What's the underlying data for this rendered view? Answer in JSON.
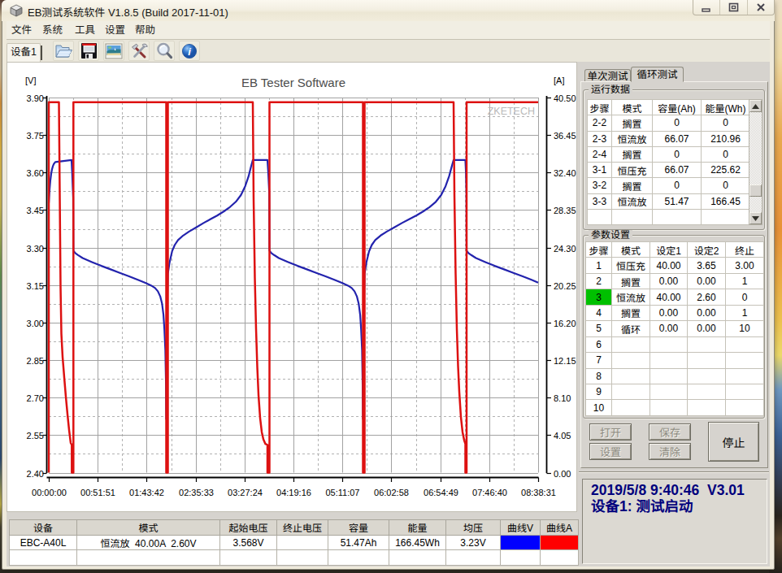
{
  "window": {
    "title": "EB测试系统软件 V1.8.5 (Build 2017-11-01)",
    "caption_buttons": {
      "minimize": "minimize",
      "maximize": "maximize",
      "close": "close"
    }
  },
  "menu": {
    "items": [
      "文件",
      "系统",
      "工具",
      "设置",
      "帮助"
    ]
  },
  "toolbar": {
    "device_tab": "设备1",
    "icons": [
      "open-file-icon",
      "save-icon",
      "export-image-icon",
      "tools-icon",
      "zoom-icon",
      "info-icon"
    ]
  },
  "right_panel": {
    "tabs": [
      {
        "label": "单次测试",
        "active": false
      },
      {
        "label": "循环测试",
        "active": true
      }
    ],
    "run_data": {
      "group_label": "运行数据",
      "columns": [
        "步骤",
        "模式",
        "容量(Ah)",
        "能量(Wh)"
      ],
      "rows": [
        [
          "2-2",
          "搁置",
          "0",
          "0"
        ],
        [
          "2-3",
          "恒流放",
          "66.07",
          "210.96"
        ],
        [
          "2-4",
          "搁置",
          "0",
          "0"
        ],
        [
          "3-1",
          "恒压充",
          "66.07",
          "225.62"
        ],
        [
          "3-2",
          "搁置",
          "0",
          "0"
        ],
        [
          "3-3",
          "恒流放",
          "51.47",
          "166.45"
        ],
        [
          "",
          "",
          "",
          ""
        ]
      ]
    },
    "parameters": {
      "group_label": "参数设置",
      "columns": [
        "步骤",
        "模式",
        "设定1",
        "设定2",
        "终止"
      ],
      "rows": [
        [
          "1",
          "恒压充",
          "40.00",
          "3.65",
          "3.00"
        ],
        [
          "2",
          "搁置",
          "0.00",
          "0.00",
          "1"
        ],
        [
          "3",
          "恒流放",
          "40.00",
          "2.60",
          "0"
        ],
        [
          "4",
          "搁置",
          "0.00",
          "0.00",
          "1"
        ],
        [
          "5",
          "循环",
          "0.00",
          "0.00",
          "10"
        ],
        [
          "6",
          "",
          "",
          "",
          ""
        ],
        [
          "7",
          "",
          "",
          "",
          ""
        ],
        [
          "8",
          "",
          "",
          "",
          ""
        ],
        [
          "9",
          "",
          "",
          "",
          ""
        ],
        [
          "10",
          "",
          "",
          "",
          ""
        ]
      ],
      "active_step_row": 3,
      "active_step_color": "#00c000"
    },
    "buttons": {
      "open": "打开",
      "save": "保存",
      "set": "设置",
      "clear": "清除",
      "stop": "停止"
    },
    "status_log": {
      "line1": "2019/5/8 9:40:46  V3.01",
      "line2": "设备1: 测试启动",
      "text_color": "#00007d"
    }
  },
  "bottom_table": {
    "columns": [
      "设备",
      "模式",
      "起始电压",
      "终止电压",
      "容量",
      "能量",
      "均压",
      "曲线V",
      "曲线A"
    ],
    "row": {
      "device": "EBC-A40L",
      "mode": "恒流放  40.00A  2.60V",
      "start_voltage": "3.568V",
      "end_voltage": "",
      "capacity": "51.47Ah",
      "energy": "166.45Wh",
      "avg_voltage": "3.23V",
      "curve_v_color": "#0000ff",
      "curve_a_color": "#ff0000"
    }
  },
  "chart_data": {
    "type": "line",
    "title": "EB Tester Software",
    "watermark": "ZKETECH",
    "x_axis": {
      "min": 0,
      "max": 31111,
      "tick_labels": [
        "00:00:00",
        "00:51:51",
        "01:43:42",
        "02:35:33",
        "03:27:24",
        "04:19:16",
        "05:11:07",
        "06:02:58",
        "06:54:49",
        "07:46:40",
        "08:38:31"
      ]
    },
    "y_left": {
      "unit": "[V]",
      "min": 2.4,
      "max": 3.9,
      "tick_labels": [
        "3.90",
        "3.75",
        "3.60",
        "3.45",
        "3.30",
        "3.15",
        "3.00",
        "2.85",
        "2.70",
        "2.55",
        "2.40"
      ]
    },
    "y_right": {
      "unit": "[A]",
      "min": 0.0,
      "max": 40.5,
      "tick_labels": [
        "40.50",
        "36.45",
        "32.40",
        "28.35",
        "24.30",
        "20.25",
        "16.20",
        "12.15",
        "8.10",
        "4.05",
        "0.00"
      ]
    },
    "grid": {
      "major_color": "#a2a2a2",
      "minor_color": "#b2b2b2",
      "minor_dashed": true
    },
    "series": [
      {
        "name": "voltage",
        "axis": "left",
        "color": "#2323ad",
        "width": 2.2,
        "points": [
          [
            0,
            3.478
          ],
          [
            52,
            3.533
          ],
          [
            103,
            3.57
          ],
          [
            155,
            3.596
          ],
          [
            207,
            3.613
          ],
          [
            258,
            3.625
          ],
          [
            310,
            3.633
          ],
          [
            362,
            3.638
          ],
          [
            413,
            3.642
          ],
          [
            1447,
            3.65
          ],
          [
            1488,
            3.6
          ],
          [
            1525,
            3.54
          ],
          [
            1550,
            3.5
          ],
          [
            1566,
            3.288
          ],
          [
            1684,
            3.278
          ],
          [
            1861,
            3.27
          ],
          [
            2156,
            3.258
          ],
          [
            2451,
            3.25
          ],
          [
            2746,
            3.242
          ],
          [
            3336,
            3.227
          ],
          [
            3927,
            3.213
          ],
          [
            4517,
            3.199
          ],
          [
            5107,
            3.185
          ],
          [
            5697,
            3.17
          ],
          [
            6169,
            3.158
          ],
          [
            6523,
            3.148
          ],
          [
            6759,
            3.138
          ],
          [
            6937,
            3.125
          ],
          [
            7084,
            3.105
          ],
          [
            7202,
            3.075
          ],
          [
            7291,
            3.03
          ],
          [
            7350,
            2.975
          ],
          [
            7409,
            2.89
          ],
          [
            7450,
            2.75
          ],
          [
            7468,
            2.615
          ],
          [
            7483,
            2.8
          ],
          [
            7509,
            3.0
          ],
          [
            7545,
            3.12
          ],
          [
            7571,
            3.195
          ],
          [
            7679,
            3.24
          ],
          [
            7841,
            3.285
          ],
          [
            8003,
            3.31
          ],
          [
            8219,
            3.33
          ],
          [
            8543,
            3.348
          ],
          [
            8921,
            3.364
          ],
          [
            9353,
            3.38
          ],
          [
            9839,
            3.398
          ],
          [
            10271,
            3.413
          ],
          [
            10703,
            3.428
          ],
          [
            11135,
            3.445
          ],
          [
            11513,
            3.462
          ],
          [
            11891,
            3.483
          ],
          [
            12215,
            3.51
          ],
          [
            12485,
            3.545
          ],
          [
            12702,
            3.585
          ],
          [
            12864,
            3.625
          ],
          [
            12972,
            3.65
          ],
          [
            13902,
            3.65
          ],
          [
            13953,
            3.6
          ],
          [
            14015,
            3.52
          ],
          [
            14031,
            3.288
          ],
          [
            14150,
            3.278
          ],
          [
            14328,
            3.27
          ],
          [
            14625,
            3.258
          ],
          [
            14922,
            3.25
          ],
          [
            15220,
            3.242
          ],
          [
            15814,
            3.227
          ],
          [
            16408,
            3.213
          ],
          [
            17003,
            3.199
          ],
          [
            17597,
            3.185
          ],
          [
            18191,
            3.17
          ],
          [
            18667,
            3.158
          ],
          [
            19023,
            3.148
          ],
          [
            19261,
            3.138
          ],
          [
            19439,
            3.125
          ],
          [
            19588,
            3.105
          ],
          [
            19707,
            3.075
          ],
          [
            19796,
            3.03
          ],
          [
            19855,
            2.975
          ],
          [
            19915,
            2.89
          ],
          [
            19956,
            2.75
          ],
          [
            19974,
            2.615
          ],
          [
            19990,
            2.8
          ],
          [
            20015,
            3.0
          ],
          [
            20052,
            3.12
          ],
          [
            20077,
            3.195
          ],
          [
            20191,
            3.24
          ],
          [
            20360,
            3.285
          ],
          [
            20530,
            3.31
          ],
          [
            20757,
            3.33
          ],
          [
            21096,
            3.348
          ],
          [
            21492,
            3.364
          ],
          [
            21945,
            3.38
          ],
          [
            22454,
            3.398
          ],
          [
            22907,
            3.413
          ],
          [
            23360,
            3.428
          ],
          [
            23812,
            3.445
          ],
          [
            24208,
            3.462
          ],
          [
            24605,
            3.483
          ],
          [
            24944,
            3.51
          ],
          [
            25227,
            3.545
          ],
          [
            25453,
            3.585
          ],
          [
            25623,
            3.625
          ],
          [
            25736,
            3.65
          ],
          [
            26486,
            3.65
          ],
          [
            26522,
            3.6
          ],
          [
            26553,
            3.52
          ],
          [
            26563,
            3.288
          ],
          [
            26682,
            3.278
          ],
          [
            26860,
            3.27
          ],
          [
            27158,
            3.258
          ],
          [
            27455,
            3.25
          ],
          [
            27752,
            3.242
          ],
          [
            28346,
            3.227
          ],
          [
            28940,
            3.213
          ],
          [
            29535,
            3.199
          ],
          [
            30129,
            3.185
          ],
          [
            30723,
            3.17
          ],
          [
            31110,
            3.16
          ]
        ]
      },
      {
        "name": "current",
        "axis": "right",
        "color": "#dd1111",
        "width": 2.5,
        "points": [
          [
            0,
            0
          ],
          [
            0,
            40
          ],
          [
            646,
            40
          ],
          [
            698,
            30
          ],
          [
            749,
            20
          ],
          [
            801,
            15
          ],
          [
            879,
            12.5
          ],
          [
            982,
            10.3
          ],
          [
            1085,
            8.2
          ],
          [
            1189,
            6.3
          ],
          [
            1292,
            4.6
          ],
          [
            1395,
            3.2
          ],
          [
            1463,
            3.0
          ],
          [
            1463,
            0
          ],
          [
            1566,
            0
          ],
          [
            1566,
            40
          ],
          [
            7468,
            40
          ],
          [
            7468,
            0
          ],
          [
            7571,
            0
          ],
          [
            7571,
            40
          ],
          [
            12972,
            40
          ],
          [
            13023,
            29.5
          ],
          [
            13101,
            21
          ],
          [
            13178,
            15.5
          ],
          [
            13256,
            11.4
          ],
          [
            13333,
            8.4
          ],
          [
            13437,
            5.9
          ],
          [
            13540,
            4.4
          ],
          [
            13643,
            3.6
          ],
          [
            13773,
            3.1
          ],
          [
            13902,
            3.0
          ],
          [
            13902,
            0
          ],
          [
            14031,
            0
          ],
          [
            14031,
            40
          ],
          [
            19974,
            40
          ],
          [
            19974,
            0
          ],
          [
            20077,
            0
          ],
          [
            20077,
            40
          ],
          [
            25736,
            40
          ],
          [
            25788,
            30
          ],
          [
            25866,
            21.5
          ],
          [
            25943,
            15.5
          ],
          [
            26021,
            11.5
          ],
          [
            26098,
            8.7
          ],
          [
            26201,
            6.0
          ],
          [
            26305,
            4.4
          ],
          [
            26408,
            3.5
          ],
          [
            26486,
            3.1
          ],
          [
            26486,
            0
          ],
          [
            26563,
            0
          ],
          [
            26563,
            40
          ],
          [
            31111,
            40
          ]
        ]
      }
    ]
  }
}
